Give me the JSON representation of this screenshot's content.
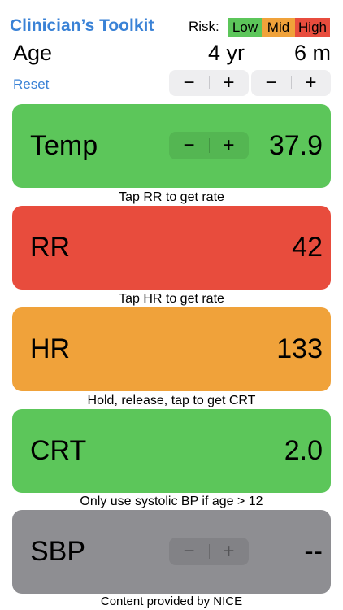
{
  "header": {
    "title": "Clinician’s Toolkit",
    "risk_label": "Risk:",
    "risk_levels": [
      {
        "label": "Low",
        "color": "#5cc65a"
      },
      {
        "label": "Mid",
        "color": "#f0a23a"
      },
      {
        "label": "High",
        "color": "#e84c3d"
      }
    ]
  },
  "age": {
    "label": "Age",
    "years": "4 yr",
    "months": "6 m",
    "reset_label": "Reset",
    "minus": "−",
    "plus": "+"
  },
  "cards": {
    "temp": {
      "label": "Temp",
      "value": "37.9",
      "color": "#5cc65a",
      "minus": "−",
      "plus": "+"
    },
    "rr": {
      "label": "RR",
      "value": "42",
      "color": "#e84c3d"
    },
    "hr": {
      "label": "HR",
      "value": "133",
      "color": "#f0a23a"
    },
    "crt": {
      "label": "CRT",
      "value": "2.0",
      "color": "#5cc65a"
    },
    "sbp": {
      "label": "SBP",
      "value": "--",
      "color": "#8e8e92",
      "minus": "−",
      "plus": "+"
    }
  },
  "hints": {
    "rr": "Tap RR to get rate",
    "hr": "Tap HR to get rate",
    "crt": "Hold, release, tap to get CRT",
    "sbp": "Only use systolic BP  if age > 12"
  },
  "footer": "Content provided by NICE"
}
